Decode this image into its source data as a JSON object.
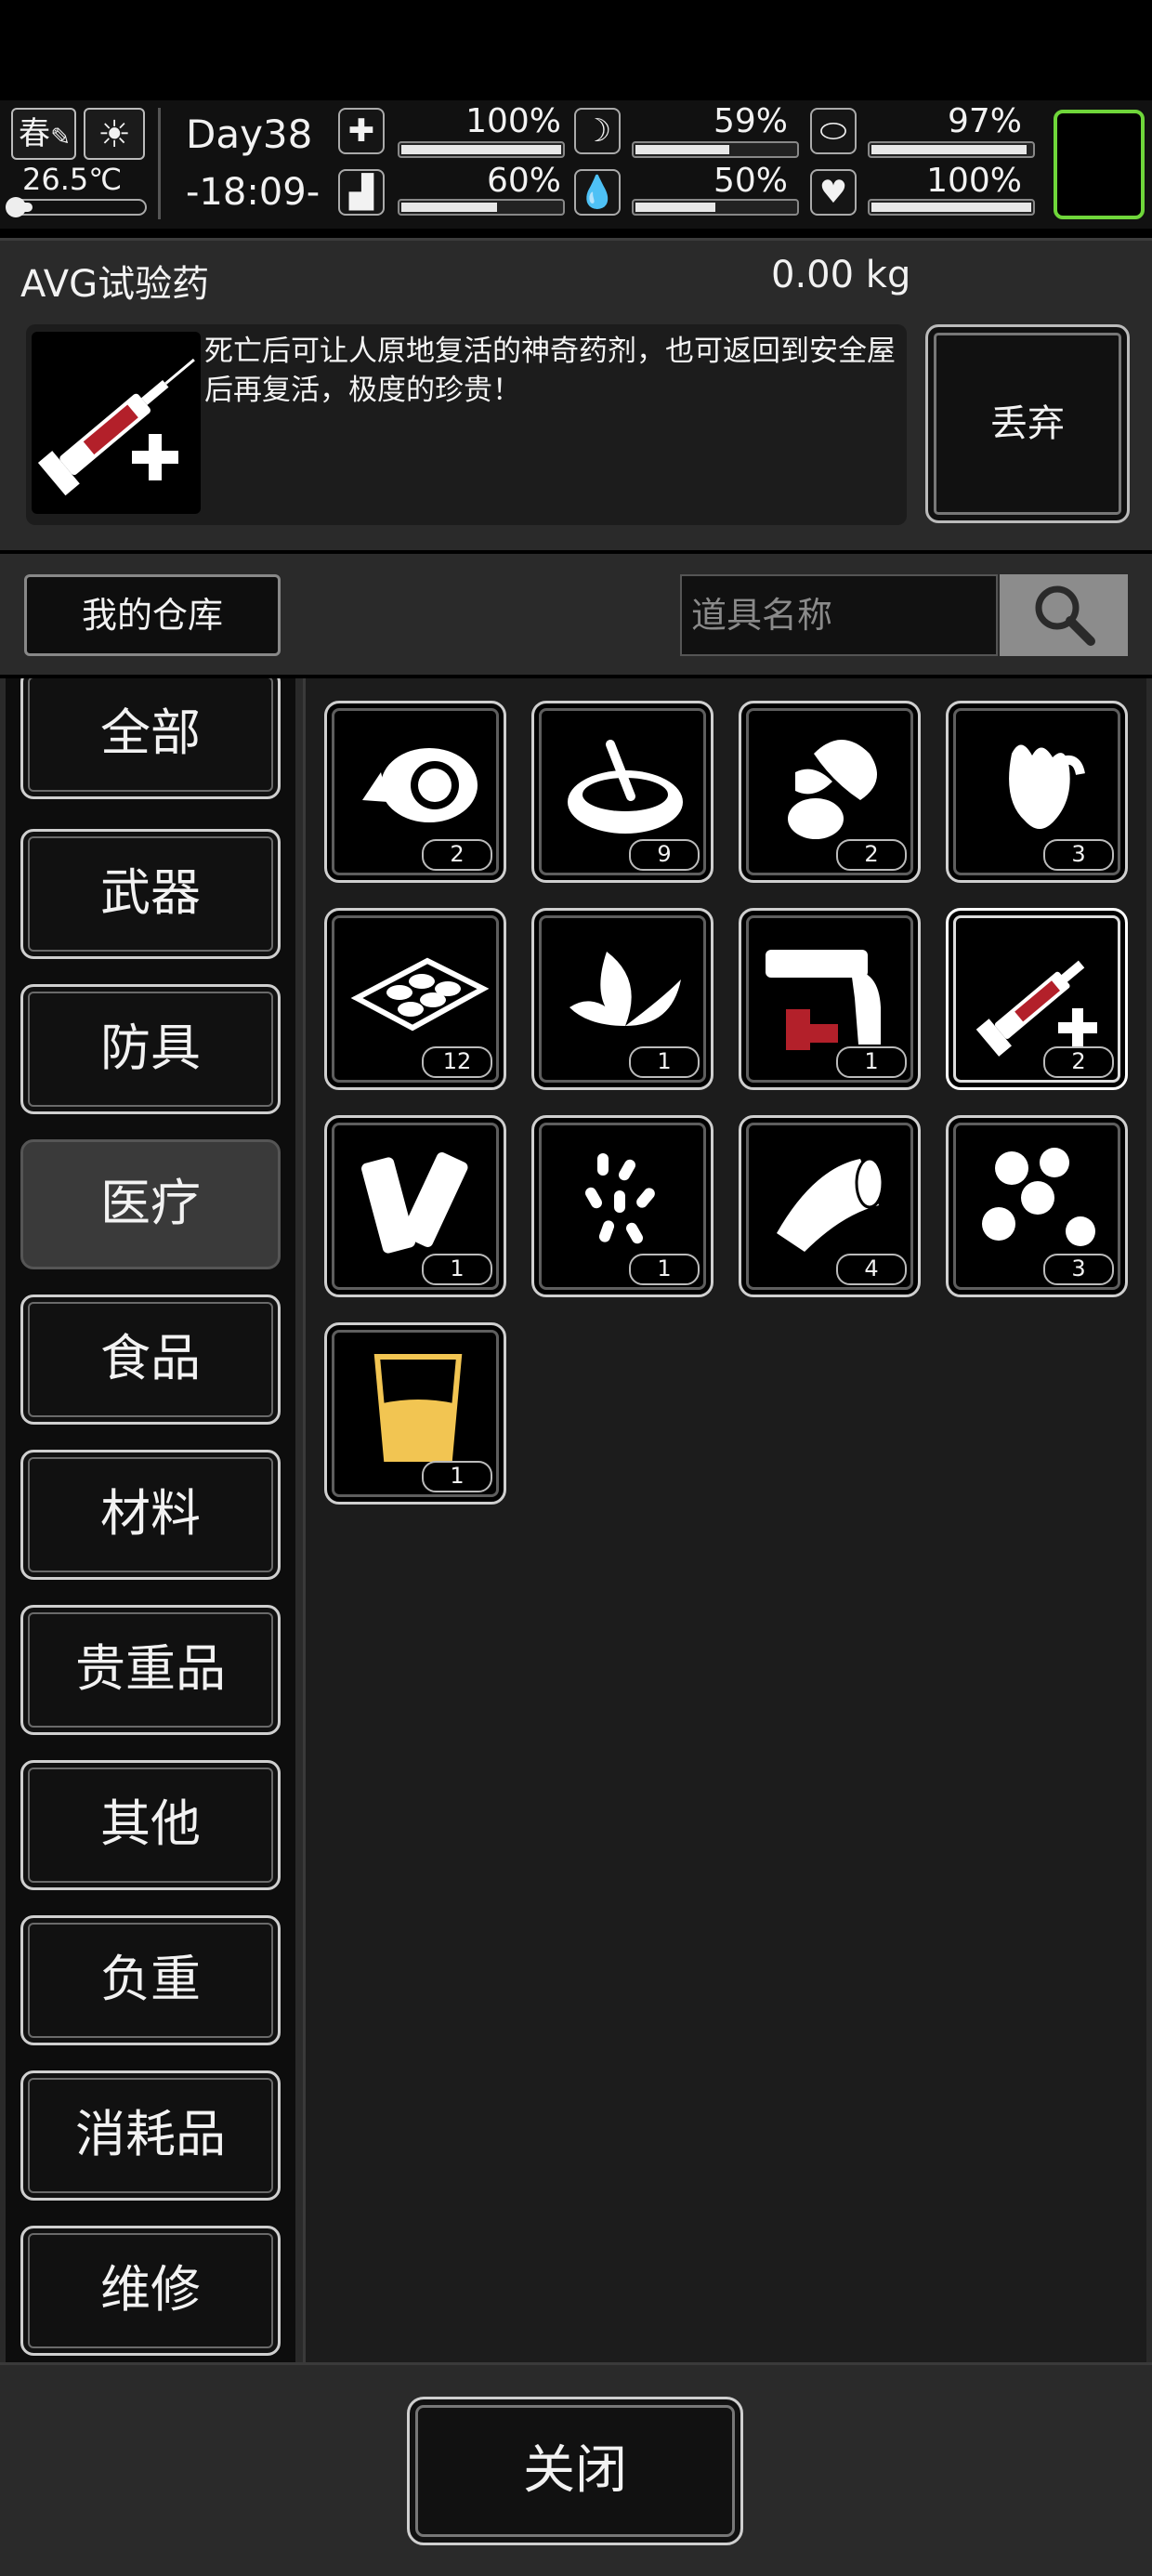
{
  "status": {
    "season": "春",
    "weather_icon": "sun-icon",
    "temperature": "26.5℃",
    "temperature_level": 0.15,
    "day": "Day38",
    "time": "-18:09-",
    "stats": [
      {
        "icon": "medkit-icon",
        "value": "100%",
        "level": 1.0
      },
      {
        "icon": "stomach-icon",
        "value": "59%",
        "level": 0.59
      },
      {
        "icon": "capsule-icon",
        "value": "97%",
        "level": 0.97
      },
      {
        "icon": "foot-icon",
        "value": "60%",
        "level": 0.6
      },
      {
        "icon": "water-drop-icon",
        "value": "50%",
        "level": 0.5
      },
      {
        "icon": "heart-icon",
        "value": "100%",
        "level": 1.0
      }
    ],
    "accent_color": "#6fd63a"
  },
  "detail": {
    "name": "AVG试验药",
    "weight": "0.00 kg",
    "description": "死亡后可让人原地复活的神奇药剂，也可返回到安全屋后再复活，极度的珍贵！",
    "icon": "syringe-plus-icon",
    "discard_label": "丢弃"
  },
  "search": {
    "warehouse_label": "我的仓库",
    "placeholder": "道具名称",
    "icon": "search-icon"
  },
  "categories": [
    "全部",
    "武器",
    "防具",
    "医疗",
    "食品",
    "材料",
    "贵重品",
    "其他",
    "负重",
    "消耗品",
    "维修"
  ],
  "active_category": "医疗",
  "items": [
    {
      "icon": "ointment-icon",
      "count": "2"
    },
    {
      "icon": "soup-bowl-icon",
      "count": "9"
    },
    {
      "icon": "herb-root-icon",
      "count": "2"
    },
    {
      "icon": "ginger-icon",
      "count": "3"
    },
    {
      "icon": "pill-tray-icon",
      "count": "12"
    },
    {
      "icon": "leaves-icon",
      "count": "1"
    },
    {
      "icon": "flare-gun-icon",
      "count": "1"
    },
    {
      "icon": "syringe-plus-icon",
      "count": "2",
      "selected": true
    },
    {
      "icon": "bandage-rolls-icon",
      "count": "1"
    },
    {
      "icon": "pills-icon",
      "count": "1"
    },
    {
      "icon": "bandage-icon",
      "count": "4"
    },
    {
      "icon": "chestnuts-icon",
      "count": "3"
    },
    {
      "icon": "cup-icon",
      "count": "1"
    }
  ],
  "close_label": "关闭"
}
